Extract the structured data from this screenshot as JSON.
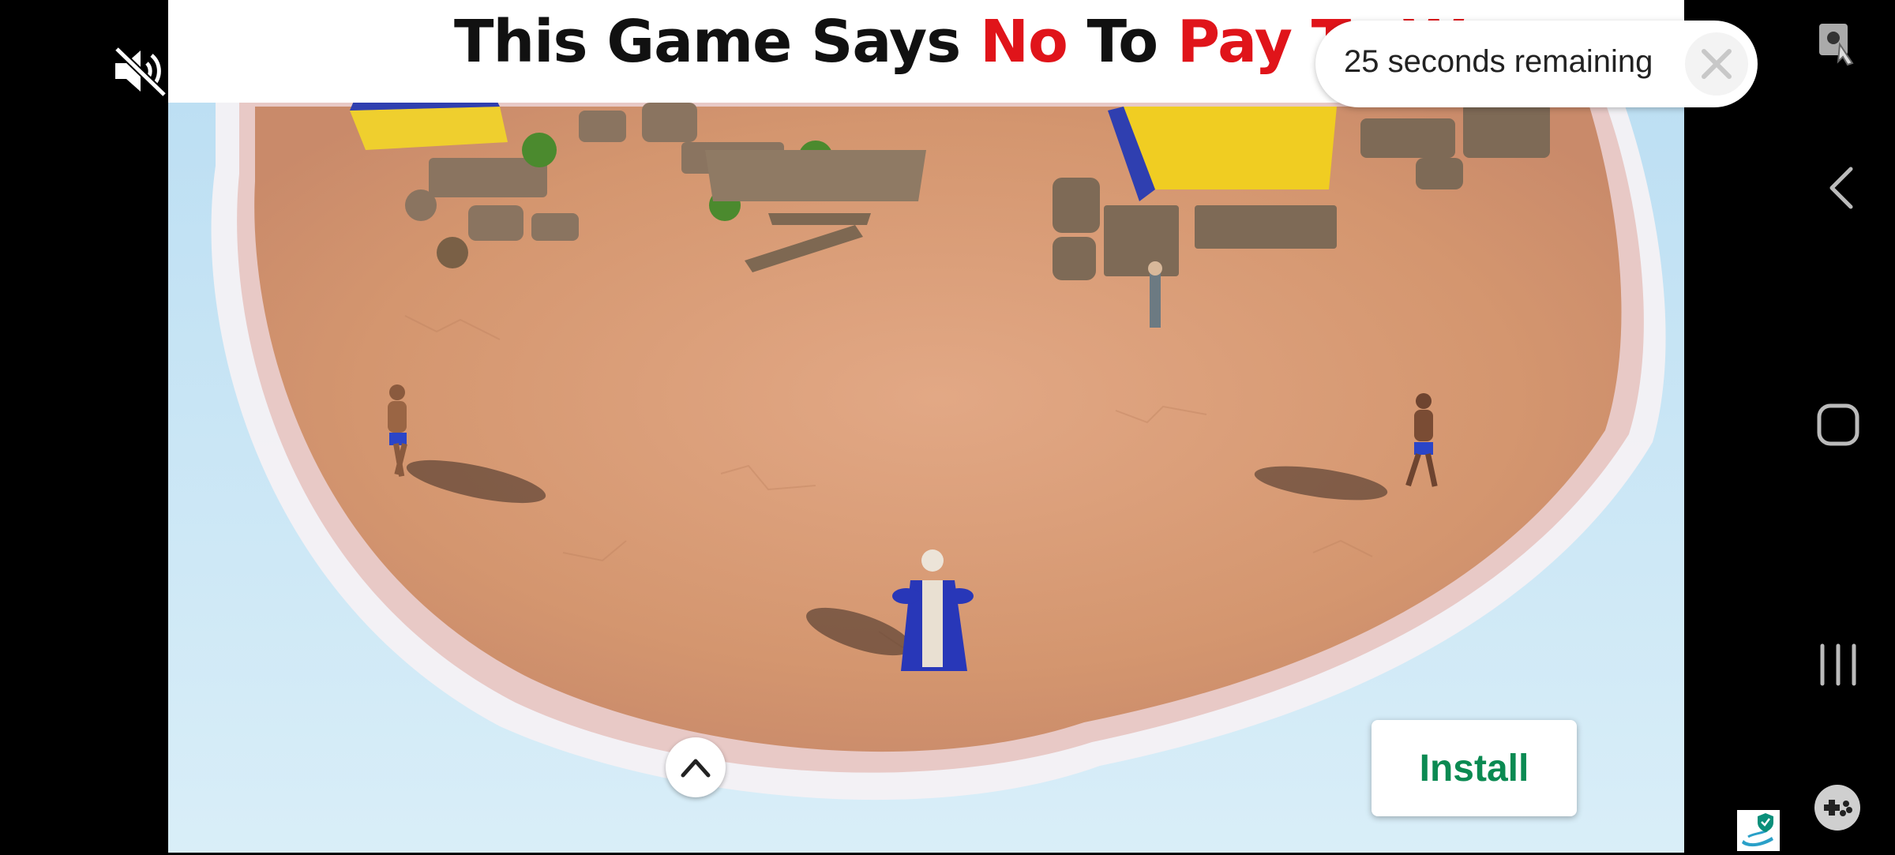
{
  "ad": {
    "banner_title_parts": {
      "part1": "This Game Says ",
      "part2": "No",
      "part3": " To ",
      "part4": "Pay To W"
    },
    "countdown_text": "25 seconds remaining",
    "install_label": "Install"
  },
  "icons": {
    "mute": "muted-speaker-icon",
    "close": "close-icon",
    "expand": "chevron-up-icon",
    "screenshot": "screenshot-icon",
    "back": "back-icon",
    "home": "home-icon",
    "recent": "recent-apps-icon",
    "game": "game-tools-icon",
    "ad_badge": "ad-choices-icon"
  },
  "colors": {
    "accent_red": "#e0141a",
    "install_green": "#0b8a52",
    "sand": "#d89a72",
    "water": "#c7e2f2"
  }
}
